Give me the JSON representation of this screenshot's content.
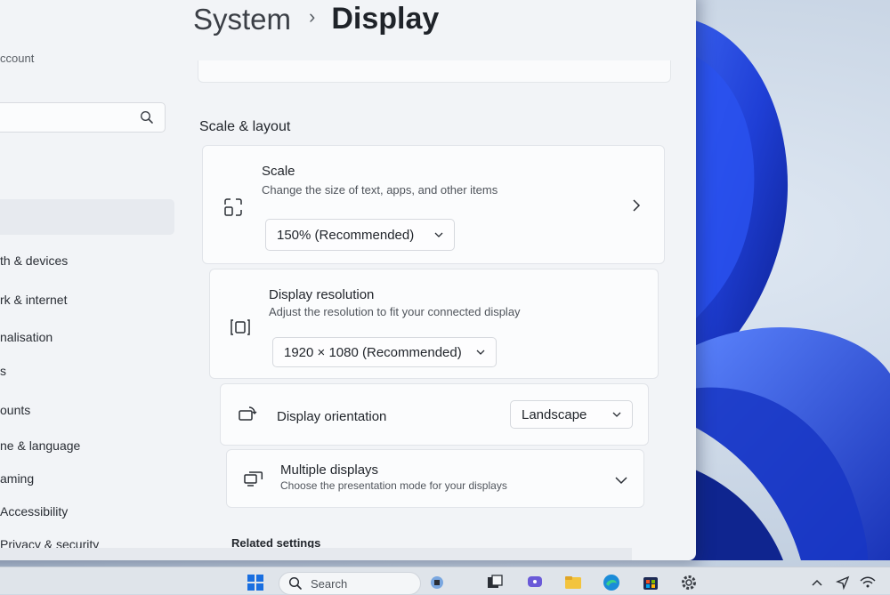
{
  "breadcrumb": {
    "parent": "System",
    "separator": "›",
    "current": "Display"
  },
  "sidebar": {
    "account_fragment": "ccount",
    "items": [
      {
        "label": "th & devices"
      },
      {
        "label": "rk & internet"
      },
      {
        "label": "nalisation"
      },
      {
        "label": "s"
      },
      {
        "label": "ounts"
      },
      {
        "label": "ne & language"
      },
      {
        "label": "aming"
      },
      {
        "label": "Accessibility"
      },
      {
        "label": "Privacy & security"
      }
    ]
  },
  "section": {
    "title": "Scale & layout"
  },
  "scale": {
    "title": "Scale",
    "description": "Change the size of text, apps, and other items",
    "value": "150% (Recommended)"
  },
  "resolution": {
    "title": "Display resolution",
    "description": "Adjust the resolution to fit your connected display",
    "value": "1920 × 1080 (Recommended)"
  },
  "orientation": {
    "title": "Display orientation",
    "value": "Landscape"
  },
  "multiple": {
    "title": "Multiple displays",
    "description": "Choose the presentation mode for your displays"
  },
  "related": {
    "title": "Related settings"
  },
  "taskbar": {
    "search_label": "Search"
  },
  "colors": {
    "wallpaper_blue": "#1f3fd6",
    "window_bg": "#f2f4f7",
    "card_bg": "#fbfcfd"
  }
}
